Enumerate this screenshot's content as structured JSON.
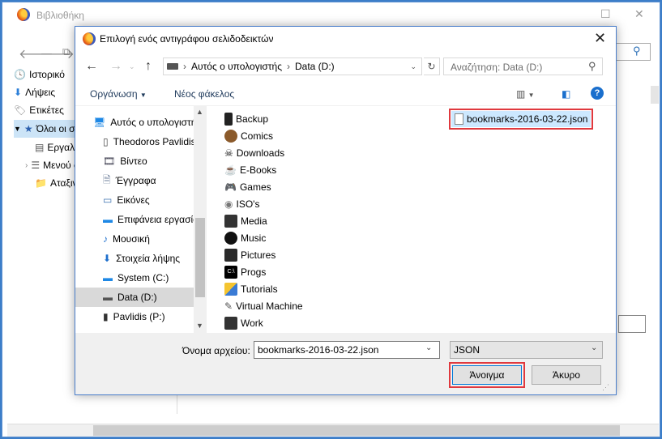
{
  "library": {
    "title": "Βιβλιοθήκη",
    "nav_items": [
      {
        "label": "Ιστορικό",
        "icon": "clock-icon"
      },
      {
        "label": "Λήψεις",
        "icon": "download-icon"
      },
      {
        "label": "Ετικέτες",
        "icon": "tag-icon"
      },
      {
        "label": "Όλοι οι σελιδοδείκτες",
        "icon": "star-folder-icon"
      },
      {
        "label": "Εργαλειοθήκη σελιδοδεικτών",
        "icon": "toolbar-icon"
      },
      {
        "label": "Μενού σελιδοδεικτών",
        "icon": "menu-icon"
      },
      {
        "label": "Αταξινόμητοι σελιδοδείκτες",
        "icon": "unsorted-icon"
      }
    ]
  },
  "dialog": {
    "title": "Επιλογή ενός αντιγράφου σελιδοδεικτών",
    "breadcrumb": [
      "Αυτός ο υπολογιστής",
      "Data (D:)"
    ],
    "search_placeholder": "Αναζήτηση: Data (D:)",
    "organize": "Οργάνωση",
    "new_folder": "Νέος φάκελος",
    "nav_items": [
      {
        "label": "Αυτός ο υπολογιστής",
        "icon": "computer-icon"
      },
      {
        "label": "Theodoros Pavlidis",
        "icon": "phone-icon"
      },
      {
        "label": "Βίντεο",
        "icon": "video-icon"
      },
      {
        "label": "Έγγραφα",
        "icon": "documents-icon"
      },
      {
        "label": "Εικόνες",
        "icon": "pictures-icon"
      },
      {
        "label": "Επιφάνεια εργασίας",
        "icon": "desktop-icon"
      },
      {
        "label": "Μουσική",
        "icon": "music-icon"
      },
      {
        "label": "Στοιχεία λήψης",
        "icon": "downloads-icon"
      },
      {
        "label": "System (C:)",
        "icon": "drive-icon"
      },
      {
        "label": "Data (D:)",
        "icon": "drive-icon"
      },
      {
        "label": "Pavlidis (P:)",
        "icon": "usb-drive-icon"
      }
    ],
    "folders": [
      "Backup",
      "Comics",
      "Downloads",
      "E-Books",
      "Games",
      "ISO's",
      "Media",
      "Music",
      "Pictures",
      "Progs",
      "Tutorials",
      "Virtual Machine",
      "Work"
    ],
    "selected_file": "bookmarks-2016-03-22.json",
    "filename_label": "Όνομα αρχείου:",
    "filename_value": "bookmarks-2016-03-22.json",
    "filetype": "JSON",
    "open_label": "Άνοιγμα",
    "cancel_label": "Άκυρο"
  }
}
